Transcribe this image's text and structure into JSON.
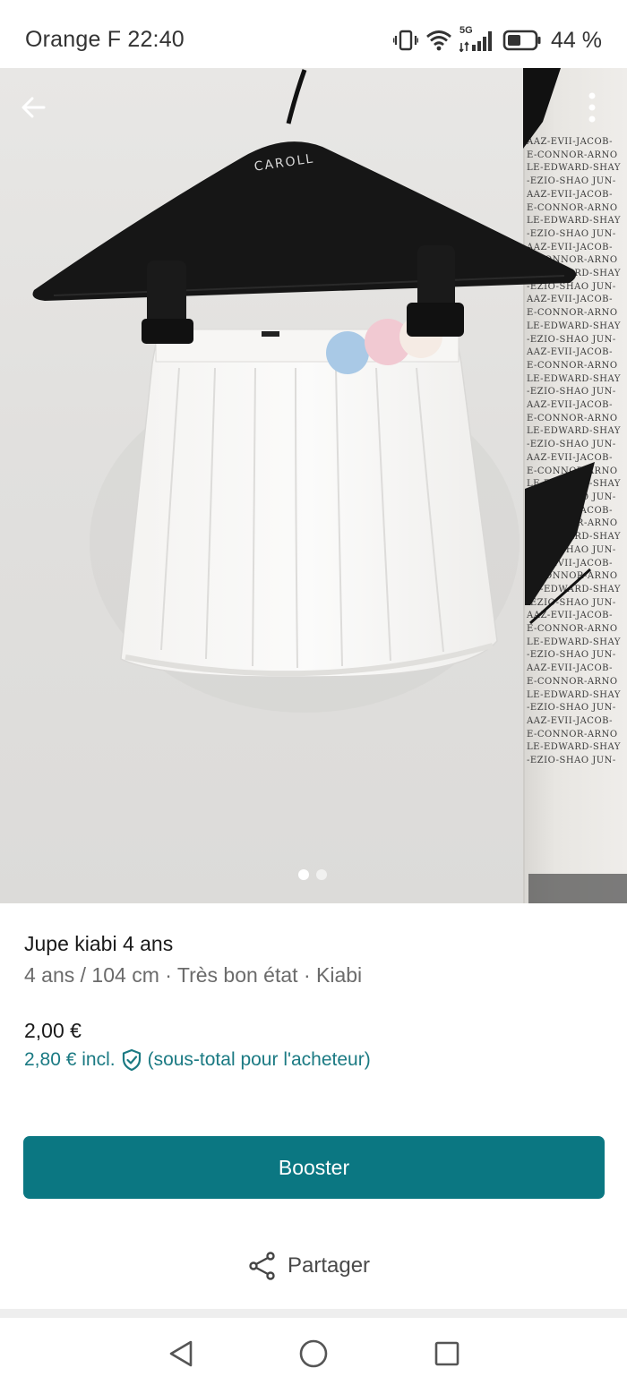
{
  "status_bar": {
    "carrier_time": "Orange F 22:40",
    "network": "5G",
    "battery": "44 %"
  },
  "photo": {
    "hanger_brand": "CAROLL",
    "poster_lines": [
      "AAZ-EVII-JACOB-",
      "E-CONNOR-ARNO",
      "LE-EDWARD-SHAY",
      "-EZIO-SHAO JUN-",
      "AAZ-EVII-JACOB-",
      "E-CONNOR-ARNO",
      "LE-EDWARD-SHAY",
      "-EZIO-SHAO JUN-",
      "AAZ-EVII-JACOB-",
      "E-CONNOR-ARNO",
      "LE-EDWARD-SHAY",
      "-EZIO-SHAO JUN-",
      "AAZ-EVII-JACOB-",
      "E-CONNOR-ARNO",
      "LE-EDWARD-SHAY",
      "-EZIO-SHAO JUN-",
      "AAZ-EVII-JACOB-",
      "E-CONNOR-ARNO",
      "LE-EDWARD-SHAY",
      "-EZIO-SHAO JUN-",
      "AAZ-EVII-JACOB-",
      "E-CONNOR-ARNO",
      "LE-EDWARD-SHAY",
      "-EZIO-SHAO JUN-",
      "AAZ-EVII-JACOB-",
      "E-CONNOR-ARNO",
      "LE-EDWARD-SHAY",
      "-EZIO-SHAO JUN-",
      "AAZ-EVII-JACOB-",
      "E-CONNOR-ARNO",
      "LE-EDWARD-SHAY",
      "-EZIO-SHAO JUN-",
      "AAZ-EVII-JACOB-",
      "E-CONNOR-ARNO",
      "LE-EDWARD-SHAY",
      "-EZIO-SHAO JUN-",
      "AAZ-EVII-JACOB-",
      "E-CONNOR-ARNO",
      "LE-EDWARD-SHAY",
      "-EZIO-SHAO JUN-",
      "AAZ-EVII-JACOB-",
      "E-CONNOR-ARNO",
      "LE-EDWARD-SHAY",
      "-EZIO-SHAO JUN-",
      "AAZ-EVII-JACOB-",
      "E-CONNOR-ARNO",
      "LE-EDWARD-SHAY",
      "-EZIO-SHAO JUN-"
    ],
    "pages_total": 2,
    "current_page": 1
  },
  "item": {
    "title": "Jupe kiabi 4 ans",
    "subtitle": "4 ans / 104 cm · Très bon état · Kiabi",
    "price": "2,00 €",
    "price_incl_amount": "2,80 €  incl.",
    "price_incl_note": "(sous-total pour l'acheteur)"
  },
  "actions": {
    "booster_label": "Booster",
    "share_label": "Partager"
  },
  "icons": {
    "back": "arrow-left-icon",
    "more": "more-vertical-icon",
    "shield": "shield-check-icon",
    "share": "share-icon",
    "nav_back": "triangle-back-icon",
    "nav_home": "circle-home-icon",
    "nav_recents": "square-recents-icon"
  },
  "colors": {
    "accent": "#0b7782",
    "accent_text": "#1b7a83"
  }
}
